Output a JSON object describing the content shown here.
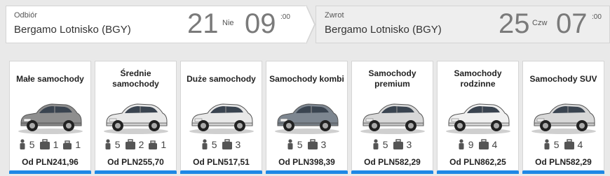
{
  "pickup": {
    "label": "Odbiór",
    "location": "Bergamo Lotnisko (BGY)",
    "day_num": "21",
    "weekday": "Nie",
    "hour": "09",
    "minutes": ":00"
  },
  "return": {
    "label": "Zwrot",
    "location": "Bergamo Lotnisko (BGY)",
    "day_num": "25",
    "weekday": "Czw",
    "hour": "07",
    "minutes": ":00"
  },
  "accent_color": "#1e88e5",
  "categories": [
    {
      "title": "Małe samochody",
      "passengers": "5",
      "big_bags": "1",
      "small_bags": "1",
      "price": "Od PLN241,96",
      "car_color": "#8e8e8e"
    },
    {
      "title": "Średnie samochody",
      "passengers": "5",
      "big_bags": "2",
      "small_bags": "1",
      "price": "Od PLN255,70",
      "car_color": "#e8e8e8"
    },
    {
      "title": "Duże samochody",
      "passengers": "5",
      "big_bags": "3",
      "small_bags": "",
      "price": "Od PLN517,51",
      "car_color": "#e8e8e8"
    },
    {
      "title": "Samochody kombi",
      "passengers": "5",
      "big_bags": "3",
      "small_bags": "",
      "price": "Od PLN398,39",
      "car_color": "#7d8690"
    },
    {
      "title": "Samochody premium",
      "passengers": "5",
      "big_bags": "3",
      "small_bags": "",
      "price": "Od PLN582,29",
      "car_color": "#d8d8d8"
    },
    {
      "title": "Samochody rodzinne",
      "passengers": "9",
      "big_bags": "4",
      "small_bags": "",
      "price": "Od PLN862,25",
      "car_color": "#f0f0f0"
    },
    {
      "title": "Samochody SUV",
      "passengers": "5",
      "big_bags": "4",
      "small_bags": "",
      "price": "Od PLN582,29",
      "car_color": "#d8d8d8"
    }
  ]
}
